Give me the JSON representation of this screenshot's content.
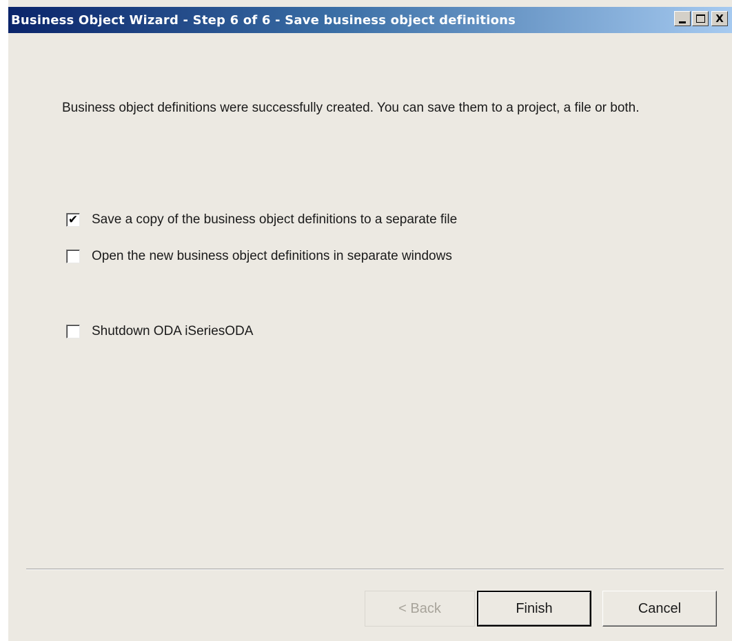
{
  "window": {
    "title": "Business Object Wizard - Step 6 of 6 - Save business object definitions",
    "controls": {
      "minimize_icon": "minimize-icon",
      "maximize_icon": "maximize-icon",
      "close_label": "X"
    }
  },
  "content": {
    "message": "Business object definitions were successfully created. You can save them to a project, a file or both."
  },
  "options": [
    {
      "label": "Save a copy of the business object definitions to a separate file",
      "checked": true,
      "mark": "✔"
    },
    {
      "label": "Open the new business object definitions in separate windows",
      "checked": false,
      "mark": ""
    },
    {
      "label": "Shutdown ODA iSeriesODA",
      "checked": false,
      "mark": ""
    }
  ],
  "buttons": {
    "back_label": "< Back",
    "back_enabled": false,
    "finish_label": "Finish",
    "cancel_label": "Cancel"
  },
  "colors": {
    "titlebar_start": "#0a246a",
    "titlebar_end": "#a6caf0",
    "dialog_bg": "#ece9e2"
  }
}
